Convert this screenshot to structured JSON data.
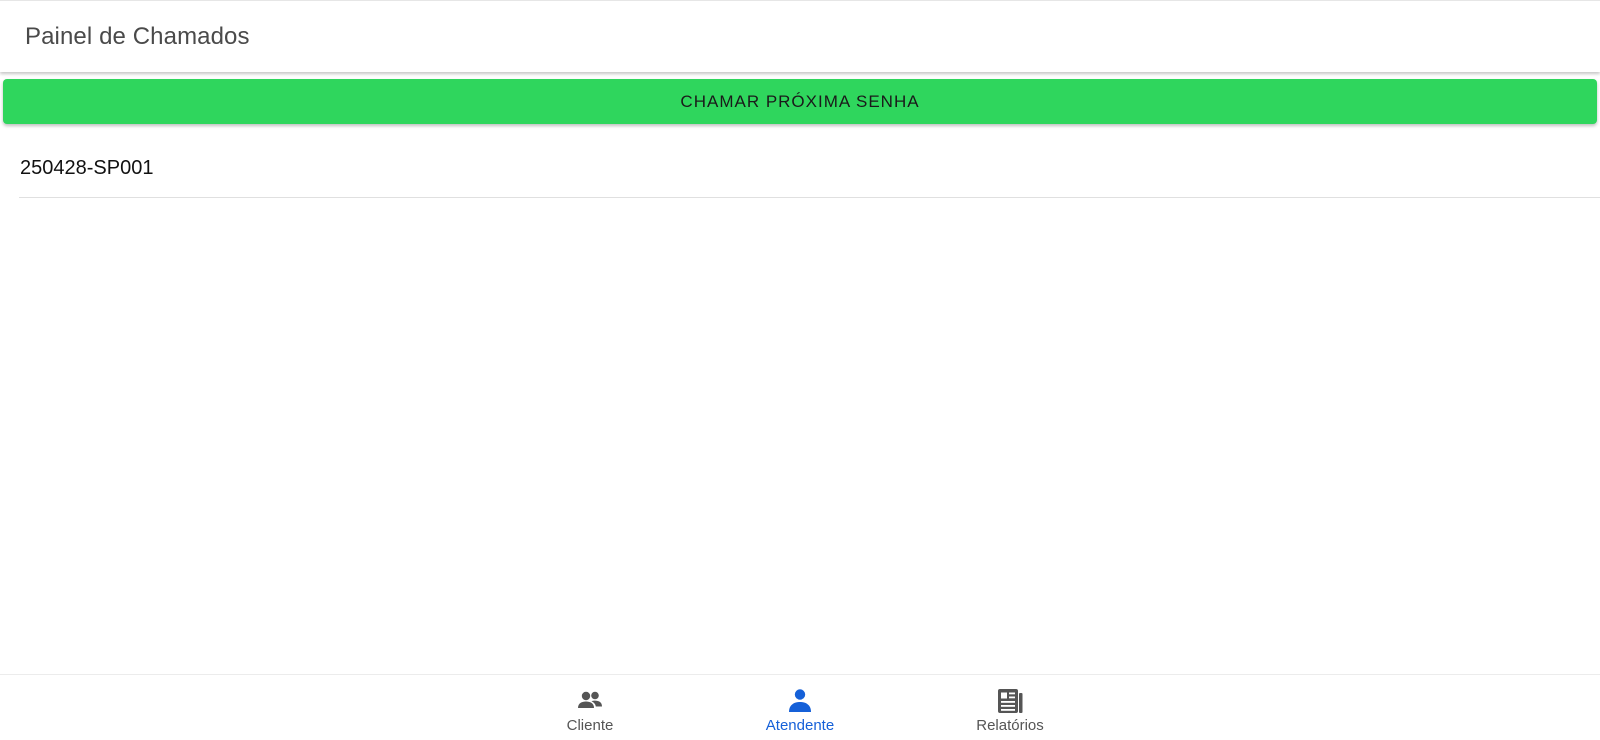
{
  "header": {
    "title": "Painel de Chamados"
  },
  "actions": {
    "call_next_label": "CHAMAR PRÓXIMA SENHA"
  },
  "tickets": [
    {
      "code": "250428-SP001"
    }
  ],
  "bottom_nav": {
    "items": [
      {
        "label": "Cliente",
        "icon": "people-icon",
        "active": false
      },
      {
        "label": "Atendente",
        "icon": "person-icon",
        "active": true
      },
      {
        "label": "Relatórios",
        "icon": "report-icon",
        "active": false
      }
    ]
  },
  "colors": {
    "primary_button": "#2fd65d",
    "active_nav": "#1560d8",
    "inactive_nav": "#555555"
  }
}
